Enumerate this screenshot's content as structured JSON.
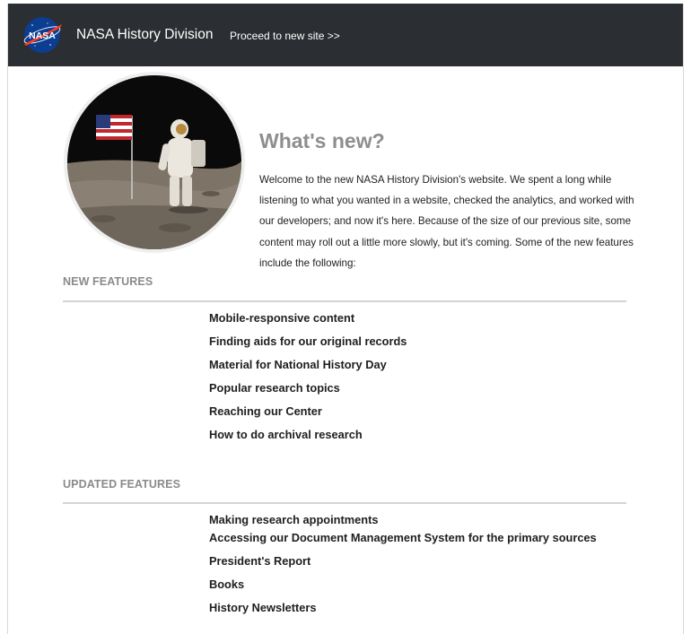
{
  "header": {
    "logo_text": "NASA",
    "site_title": "NASA History Division",
    "proceed_link": "Proceed to new site >>"
  },
  "main": {
    "heading": "What's new?",
    "intro": "Welcome to the new NASA History Division's website. We spent a long while listening to what you wanted in a website, checked the analytics, and worked with our developers; and now it's here. Because of the size of our previous site, some content may roll out a little more slowly, but it's coming. Some of the new features include the following:"
  },
  "new_features": {
    "heading": "NEW FEATURES",
    "items": [
      "Mobile-responsive content",
      "Finding aids for our original records",
      "Material for National History Day",
      "Popular research topics",
      "Reaching our Center",
      "How to do archival research"
    ]
  },
  "updated_features": {
    "heading": "UPDATED FEATURES",
    "items": [
      "Making research appointments",
      "Accessing our Document Management System for the primary sources",
      "President's Report",
      "Books",
      "History Newsletters"
    ]
  },
  "colors": {
    "header_bg": "#2b2e32",
    "nasa_blue": "#0b3d91",
    "nasa_red": "#fc3d21"
  }
}
